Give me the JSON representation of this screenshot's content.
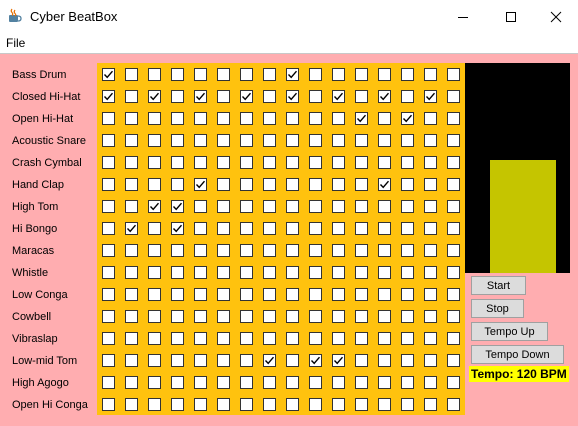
{
  "window": {
    "title": "Cyber BeatBox",
    "icon": "java-coffee-icon",
    "controls": [
      "minimize-icon",
      "maximize-icon",
      "close-icon"
    ]
  },
  "menu": {
    "items": [
      "File"
    ]
  },
  "instruments": [
    "Bass Drum",
    "Closed Hi-Hat",
    "Open Hi-Hat",
    "Acoustic Snare",
    "Crash Cymbal",
    "Hand Clap",
    "High Tom",
    "Hi Bongo",
    "Maracas",
    "Whistle",
    "Low Conga",
    "Cowbell",
    "Vibraslap",
    "Low-mid Tom",
    "High Agogo",
    "Open Hi Conga"
  ],
  "steps": 16,
  "checked": [
    [
      0,
      8
    ],
    [
      0,
      2,
      4,
      6,
      8,
      10,
      12,
      14
    ],
    [
      11,
      13
    ],
    [],
    [],
    [
      4,
      12
    ],
    [
      2,
      3
    ],
    [
      1,
      3
    ],
    [],
    [],
    [],
    [],
    [],
    [
      7,
      9,
      10
    ],
    [],
    []
  ],
  "level_meter": {
    "fill_fraction": 0.54
  },
  "buttons": {
    "start": "Start",
    "stop": "Stop",
    "tempo_up": "Tempo Up",
    "tempo_down": "Tempo Down"
  },
  "tempo_label": "Tempo: 120 BPM",
  "colors": {
    "background": "#ffadb0",
    "grid": "#ffc20e",
    "meter_bg": "#000000",
    "meter_bar": "#c5c500",
    "tempo_highlight": "#ffff00"
  }
}
